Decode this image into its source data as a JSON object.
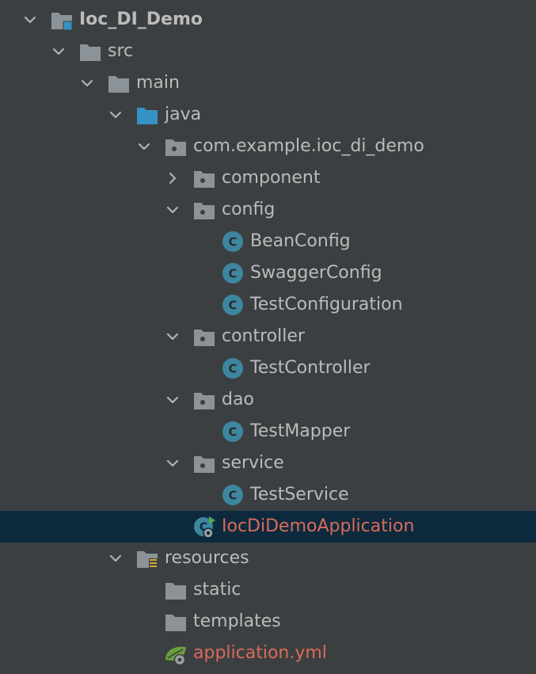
{
  "colors": {
    "background": "#3c3f41",
    "selection": "#0d293e",
    "text": "#bbbbbb",
    "modified_text": "#d86b59",
    "folder": "#8c9398",
    "source_folder": "#3592c4",
    "class_circle": "#3e86a0",
    "spring_green": "#6a9f3c",
    "resources_bars": "#d9a53f"
  },
  "tree": [
    {
      "label": "Ioc_DI_Demo",
      "icon": "module-folder-icon",
      "expanded": true
    },
    {
      "label": "src",
      "icon": "folder-icon",
      "expanded": true
    },
    {
      "label": "main",
      "icon": "folder-icon",
      "expanded": true
    },
    {
      "label": "java",
      "icon": "source-root-folder-icon",
      "expanded": true
    },
    {
      "label": "com.example.ioc_di_demo",
      "icon": "package-icon",
      "expanded": true
    },
    {
      "label": "component",
      "icon": "package-icon",
      "expanded": false
    },
    {
      "label": "config",
      "icon": "package-icon",
      "expanded": true
    },
    {
      "label": "BeanConfig",
      "icon": "class-icon"
    },
    {
      "label": "SwaggerConfig",
      "icon": "class-icon"
    },
    {
      "label": "TestConfiguration",
      "icon": "class-icon"
    },
    {
      "label": "controller",
      "icon": "package-icon",
      "expanded": true
    },
    {
      "label": "TestController",
      "icon": "class-icon"
    },
    {
      "label": "dao",
      "icon": "package-icon",
      "expanded": true
    },
    {
      "label": "TestMapper",
      "icon": "class-icon"
    },
    {
      "label": "service",
      "icon": "package-icon",
      "expanded": true
    },
    {
      "label": "TestService",
      "icon": "class-icon"
    },
    {
      "label": "IocDiDemoApplication",
      "icon": "spring-boot-application-icon",
      "selected": true,
      "modified": true
    },
    {
      "label": "resources",
      "icon": "resources-root-folder-icon",
      "expanded": true
    },
    {
      "label": "static",
      "icon": "folder-icon"
    },
    {
      "label": "templates",
      "icon": "folder-icon"
    },
    {
      "label": "application.yml",
      "icon": "spring-config-file-icon",
      "modified": true
    }
  ]
}
